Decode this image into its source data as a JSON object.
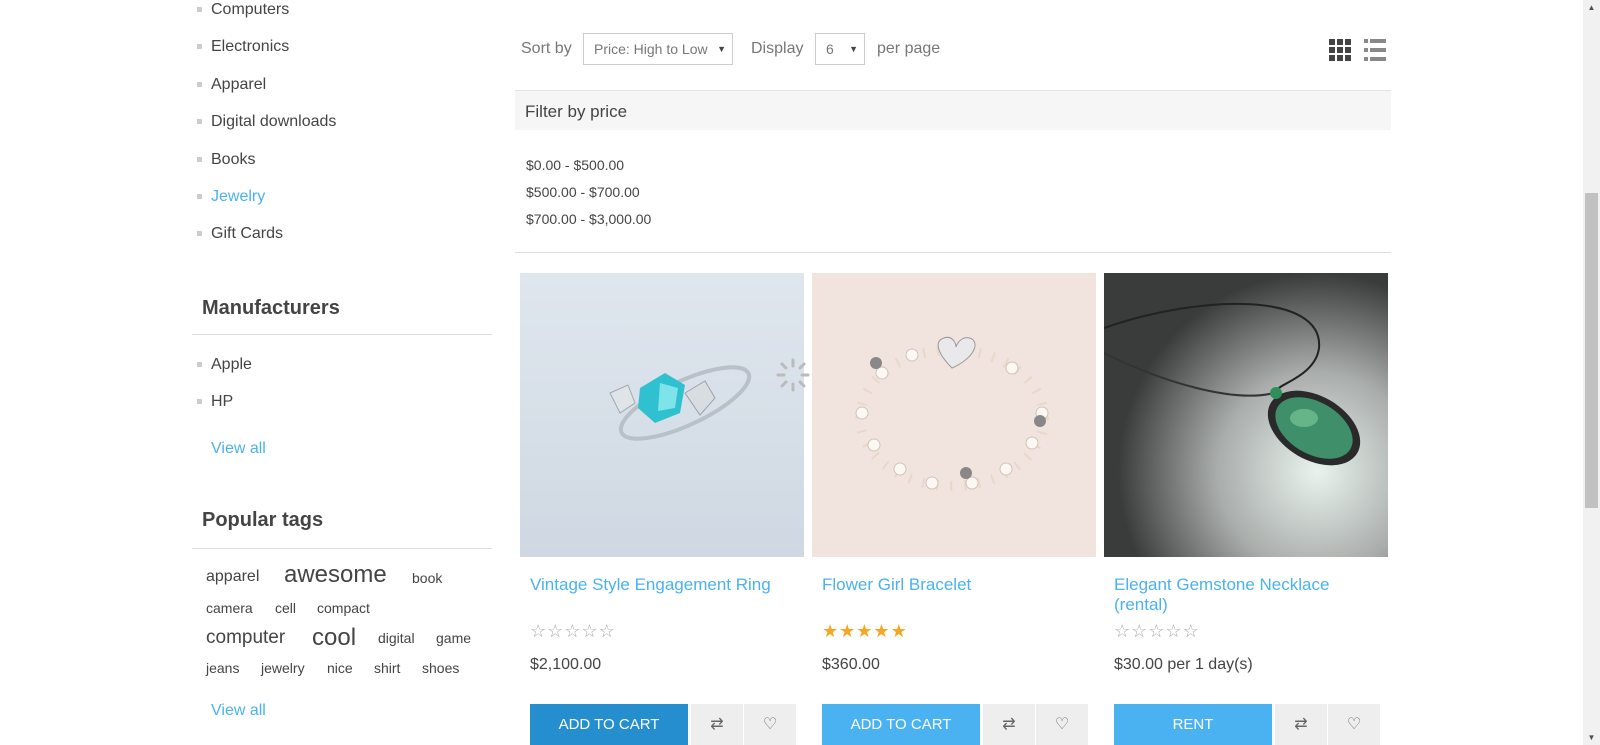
{
  "categories": [
    {
      "label": "Computers"
    },
    {
      "label": "Electronics"
    },
    {
      "label": "Apparel"
    },
    {
      "label": "Digital downloads"
    },
    {
      "label": "Books"
    },
    {
      "label": "Jewelry",
      "active": true
    },
    {
      "label": "Gift Cards"
    }
  ],
  "manufacturers": {
    "title": "Manufacturers",
    "items": [
      "Apple",
      "HP"
    ],
    "view_all": "View all"
  },
  "tags": {
    "title": "Popular tags",
    "items": [
      "apparel",
      "awesome",
      "book",
      "camera",
      "cell",
      "compact",
      "computer",
      "cool",
      "digital",
      "game",
      "jeans",
      "jewelry",
      "nice",
      "shirt",
      "shoes"
    ],
    "view_all": "View all"
  },
  "toolbar": {
    "sort_label": "Sort by",
    "sort_value": "Price: High to Low",
    "display_label": "Display",
    "display_value": "6",
    "per_page": "per page"
  },
  "filter": {
    "title": "Filter by price",
    "ranges": [
      "$0.00 - $500.00",
      "$500.00 - $700.00",
      "$700.00 - $3,000.00"
    ]
  },
  "products": [
    {
      "title": "Vintage Style Engagement Ring",
      "rating": 0,
      "price": "$2,100.00",
      "button": "ADD TO CART"
    },
    {
      "title": "Flower Girl Bracelet",
      "rating": 5,
      "price": "$360.00",
      "button": "ADD TO CART"
    },
    {
      "title": "Elegant Gemstone Necklace (rental)",
      "rating": 0,
      "price": "$30.00 per 1 day(s)",
      "button": "RENT"
    }
  ],
  "colors": {
    "accent": "#4ab2f1",
    "button_hover": "#248ece",
    "star_filled": "#f5a623"
  }
}
